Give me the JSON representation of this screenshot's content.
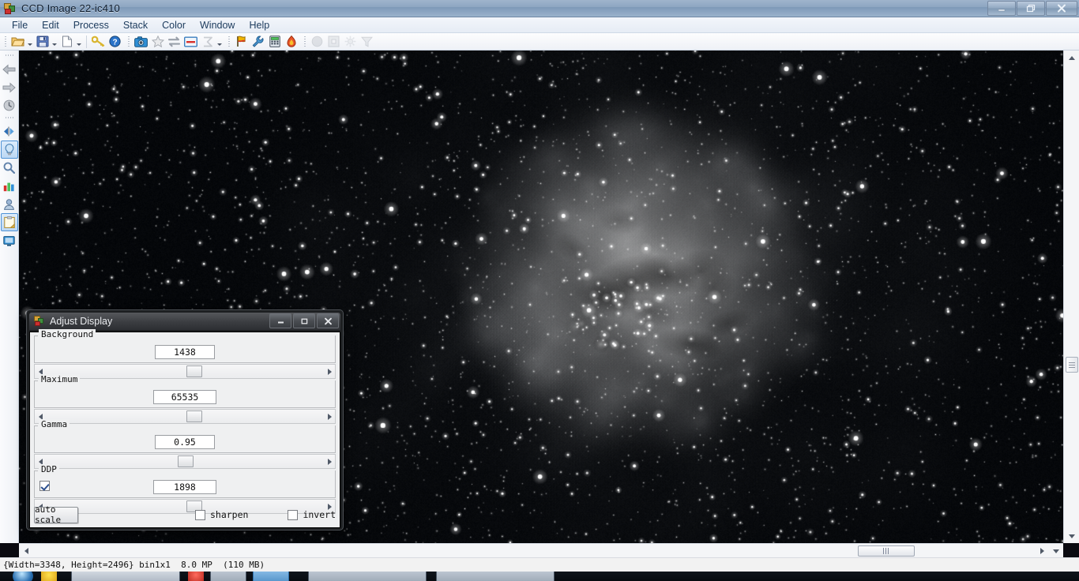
{
  "window": {
    "title": "CCD Image 22-ic410",
    "icon": "ccd-app-icon",
    "controls": {
      "minimize": "minimize",
      "restore": "restore",
      "close": "close"
    }
  },
  "menubar": {
    "items": [
      {
        "label": "File"
      },
      {
        "label": "Edit"
      },
      {
        "label": "Process"
      },
      {
        "label": "Stack"
      },
      {
        "label": "Color"
      },
      {
        "label": "Window"
      },
      {
        "label": "Help"
      }
    ]
  },
  "toolbar": {
    "groups": [
      {
        "buttons": [
          {
            "icon": "open-folder-icon",
            "enabled": true,
            "caret": true
          },
          {
            "icon": "save-disk-icon",
            "enabled": true,
            "caret": true
          },
          {
            "icon": "new-page-icon",
            "enabled": true,
            "caret": true
          },
          {
            "icon": "key-icon",
            "enabled": true,
            "caret": false
          },
          {
            "icon": "help-circle-icon",
            "enabled": true,
            "caret": false
          }
        ]
      },
      {
        "buttons": [
          {
            "icon": "camera-icon",
            "enabled": true,
            "caret": false
          },
          {
            "icon": "star-icon",
            "enabled": true,
            "caret": false
          },
          {
            "icon": "swap-arrows-icon",
            "enabled": true,
            "caret": false
          },
          {
            "icon": "adjust-display-icon",
            "enabled": true,
            "caret": false
          },
          {
            "icon": "sigma-stack-icon",
            "enabled": false,
            "caret": true
          }
        ]
      },
      {
        "buttons": [
          {
            "icon": "flag-icon",
            "enabled": true,
            "caret": false
          },
          {
            "icon": "wrench-icon",
            "enabled": true,
            "caret": false
          },
          {
            "icon": "calculator-icon",
            "enabled": true,
            "caret": false
          },
          {
            "icon": "flame-icon",
            "enabled": true,
            "caret": false
          }
        ]
      },
      {
        "buttons": [
          {
            "icon": "sphere-icon",
            "enabled": false,
            "caret": false
          },
          {
            "icon": "frame-icon",
            "enabled": false,
            "caret": false
          },
          {
            "icon": "sun-burst-icon",
            "enabled": false,
            "caret": false
          },
          {
            "icon": "funnel-filter-icon",
            "enabled": false,
            "caret": false
          }
        ]
      }
    ]
  },
  "leftbar": {
    "items": [
      {
        "icon": "back-arrow-icon",
        "selected": false
      },
      {
        "icon": "forward-arrow-icon",
        "selected": false
      },
      {
        "icon": "history-clock-icon",
        "selected": false
      },
      {
        "icon": "flip-horizontal-icon",
        "selected": false
      },
      {
        "icon": "lightbulb-icon",
        "selected": true
      },
      {
        "icon": "magnifier-icon",
        "selected": false
      },
      {
        "icon": "bar-chart-icon",
        "selected": false
      },
      {
        "icon": "user-icon",
        "selected": false
      },
      {
        "icon": "clipboard-icon",
        "selected": true
      },
      {
        "icon": "monitor-icon",
        "selected": false
      }
    ]
  },
  "image": {
    "name": "IC 410 nebula grayscale astrophotograph",
    "background_color": "#05070a"
  },
  "dialog": {
    "title": "Adjust Display",
    "icon": "adjust-display-icon",
    "controls": {
      "minimize": "minimize",
      "restore": "restore",
      "close": "close"
    },
    "sections": [
      {
        "label": "Background",
        "value": "1438",
        "slider_pct": 50.5,
        "checkbox": null
      },
      {
        "label": "Maximum",
        "value": "65535",
        "slider_pct": 50.5,
        "checkbox": null
      },
      {
        "label": "Gamma",
        "value": "0.95",
        "slider_pct": 47.5,
        "checkbox": null
      },
      {
        "label": "DDP",
        "value": "1898",
        "slider_pct": 50.5,
        "checkbox": {
          "name": "ddp-enable",
          "checked": true
        }
      }
    ],
    "footer": {
      "auto_scale_label": "auto scale",
      "sharpen_label": "sharpen",
      "sharpen_checked": false,
      "invert_label": "invert",
      "invert_checked": false
    }
  },
  "statusbar": {
    "text": "{Width=3348, Height=2496} bin1x1  8.0 MP  (110 MB)"
  },
  "scrollbars": {
    "vertical": {
      "thumb_top_pct": 62
    },
    "horizontal": {
      "thumb_left_pct": 80
    }
  }
}
